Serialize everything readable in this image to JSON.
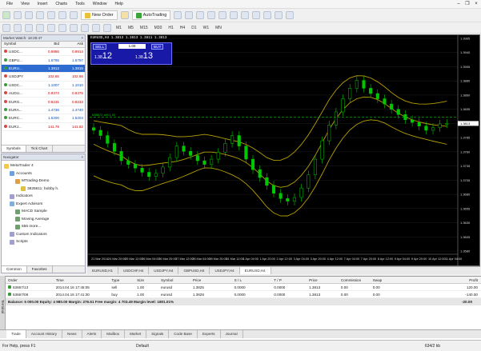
{
  "menu": [
    "File",
    "View",
    "Insert",
    "Charts",
    "Tools",
    "Window",
    "Help"
  ],
  "toolbar": {
    "new_order": "New Order",
    "auto_trading": "AutoTrading",
    "timeframes": [
      "M1",
      "M5",
      "M15",
      "M30",
      "H1",
      "H4",
      "D1",
      "W1",
      "MN"
    ]
  },
  "market_watch": {
    "title": "Market Watch: 18:28:47",
    "columns": [
      "Symbol",
      "Bid",
      "Ask"
    ],
    "rows": [
      {
        "symbol": "USDC...",
        "bid": "0.9886",
        "ask": "0.9914",
        "up": false,
        "selected": false
      },
      {
        "symbol": "GBPU...",
        "bid": "1.6795",
        "ask": "1.6797",
        "up": true,
        "selected": false
      },
      {
        "symbol": "EURU...",
        "bid": "1.3813",
        "ask": "1.3815",
        "up": true,
        "selected": true
      },
      {
        "symbol": "USDJPY",
        "bid": "102.65",
        "ask": "102.66",
        "up": false,
        "selected": false
      },
      {
        "symbol": "USDC...",
        "bid": "1.1007",
        "ask": "1.1010",
        "up": true,
        "selected": false
      },
      {
        "symbol": "AUDU...",
        "bid": "0.9374",
        "ask": "0.9376",
        "up": false,
        "selected": false
      },
      {
        "symbol": "EURG...",
        "bid": "0.8231",
        "ask": "0.8233",
        "up": false,
        "selected": false
      },
      {
        "symbol": "EURA...",
        "bid": "1.4736",
        "ask": "1.4740",
        "up": true,
        "selected": false
      },
      {
        "symbol": "EURC...",
        "bid": "1.5200",
        "ask": "1.5204",
        "up": true,
        "selected": false
      },
      {
        "symbol": "EURJ...",
        "bid": "141.79",
        "ask": "141.82",
        "up": false,
        "selected": false
      }
    ],
    "tabs": [
      "Symbols",
      "Tick Chart"
    ]
  },
  "navigator": {
    "title": "Navigator",
    "items": [
      {
        "label": "MetaTrader 4",
        "indent": 0
      },
      {
        "label": "Accounts",
        "indent": 1
      },
      {
        "label": "MTrading-Demo",
        "indent": 2
      },
      {
        "label": "3825611: bobby h.",
        "indent": 3
      },
      {
        "label": "Indicators",
        "indent": 1
      },
      {
        "label": "Expert Advisors",
        "indent": 1
      },
      {
        "label": "MACD Sample",
        "indent": 2
      },
      {
        "label": "Moving Average",
        "indent": 2
      },
      {
        "label": "556 more...",
        "indent": 2
      },
      {
        "label": "Custom Indicators",
        "indent": 1
      },
      {
        "label": "Scripts",
        "indent": 1
      }
    ],
    "tabs": [
      "Common",
      "Favorites"
    ]
  },
  "chart": {
    "title": "EURUSD,H4  1.3813 1.3813 1.3811 1.3813",
    "one_click": {
      "sell_label": "SELL",
      "buy_label": "BUY",
      "lot": "1.00",
      "sell_price_small": "1.38",
      "sell_price_big": "12",
      "buy_price_small": "1.38",
      "buy_price_big": "13"
    },
    "ask_line_label": "#38672 sell 1.00",
    "price_ticks": [
      "1.3965",
      "1.3940",
      "1.3905",
      "1.3880",
      "1.3860",
      "1.3835",
      "1.3810",
      "1.3785",
      "1.3760",
      "1.3735",
      "1.3705",
      "1.3680",
      "1.3655",
      "1.3630",
      "1.3605",
      "1.3580"
    ],
    "time_ticks": [
      "21 Mar 2014",
      "24 Mar 20:00",
      "25 Mar 12:00",
      "26 Mar 04:00",
      "26 Mar 20:00",
      "27 Mar 12:00",
      "28 Mar 04:00",
      "28 Mar 20:00",
      "31 Mar 12:00",
      "1 Apr 04:00",
      "1 Apr 20:00",
      "2 Apr 12:00",
      "3 Apr 04:00",
      "3 Apr 20:00",
      "4 Apr 12:00",
      "7 Apr 04:00",
      "7 Apr 20:00",
      "8 Apr 12:00",
      "9 Apr 04:00",
      "9 Apr 20:00",
      "10 Apr 12:00",
      "11 Apr 04:00"
    ]
  },
  "chart_data": {
    "type": "line",
    "candles_close": [
      1.38,
      1.379,
      1.3775,
      1.376,
      1.3742,
      1.3735,
      1.3728,
      1.372,
      1.3712,
      1.3718,
      1.373,
      1.3748,
      1.377,
      1.376,
      1.3752,
      1.3742,
      1.3735,
      1.3745,
      1.3758,
      1.3775,
      1.379,
      1.377,
      1.3745,
      1.3725,
      1.371,
      1.3695,
      1.368,
      1.367,
      1.3665,
      1.3672,
      1.369,
      1.3715,
      1.3745,
      1.378,
      1.381,
      1.3835,
      1.386,
      1.388,
      1.3895,
      1.388,
      1.387,
      1.386,
      1.385,
      1.384,
      1.383,
      1.382,
      1.3815,
      1.3808,
      1.38,
      1.3805,
      1.3812,
      1.3813
    ]
  },
  "chart_tabs": [
    "EURUSD,H1",
    "USDCHF,H4",
    "USDJPY,H4",
    "GBPUSD,H4",
    "USDJPY,H4",
    "EURUSD,H4"
  ],
  "terminal": {
    "columns": [
      "Order",
      "Time",
      "Type",
      "Size",
      "Symbol",
      "Price",
      "S / L",
      "T / P",
      "Price",
      "Commission",
      "Swap",
      "Profit"
    ],
    "rows": [
      {
        "order": "53667/13",
        "time": "2014.04.16 17:45:05",
        "type": "sell",
        "size": "1.00",
        "symbol": "eurusd",
        "price": "1.3825",
        "sl": "0.0000",
        "tp": "0.0000",
        "cur": "1.3813",
        "comm": "0.00",
        "swap": "0.00",
        "profit": "120.00"
      },
      {
        "order": "53667/08",
        "time": "2014.04.16 17:41:30",
        "type": "buy",
        "size": "1.00",
        "symbol": "eurusd",
        "price": "1.3828",
        "sl": "0.0000",
        "tp": "0.0000",
        "cur": "1.3813",
        "comm": "0.00",
        "swap": "0.00",
        "profit": "-140.00"
      }
    ],
    "balance": "Balance: 5 000.00  Equity: 4 980.00  Margin: 276.51  Free margin: 4 703.49  Margin level: 1801.01%",
    "balance_profit": "-20.00",
    "side_label": "Terminal",
    "tabs": [
      "Trade",
      "Account History",
      "News",
      "Alerts",
      "Mailbox",
      "Market",
      "Signals",
      "Code Base",
      "Experts",
      "Journal"
    ]
  },
  "status": {
    "help": "For Help, press F1",
    "profile": "Default",
    "traffic": "634/2 kb"
  }
}
